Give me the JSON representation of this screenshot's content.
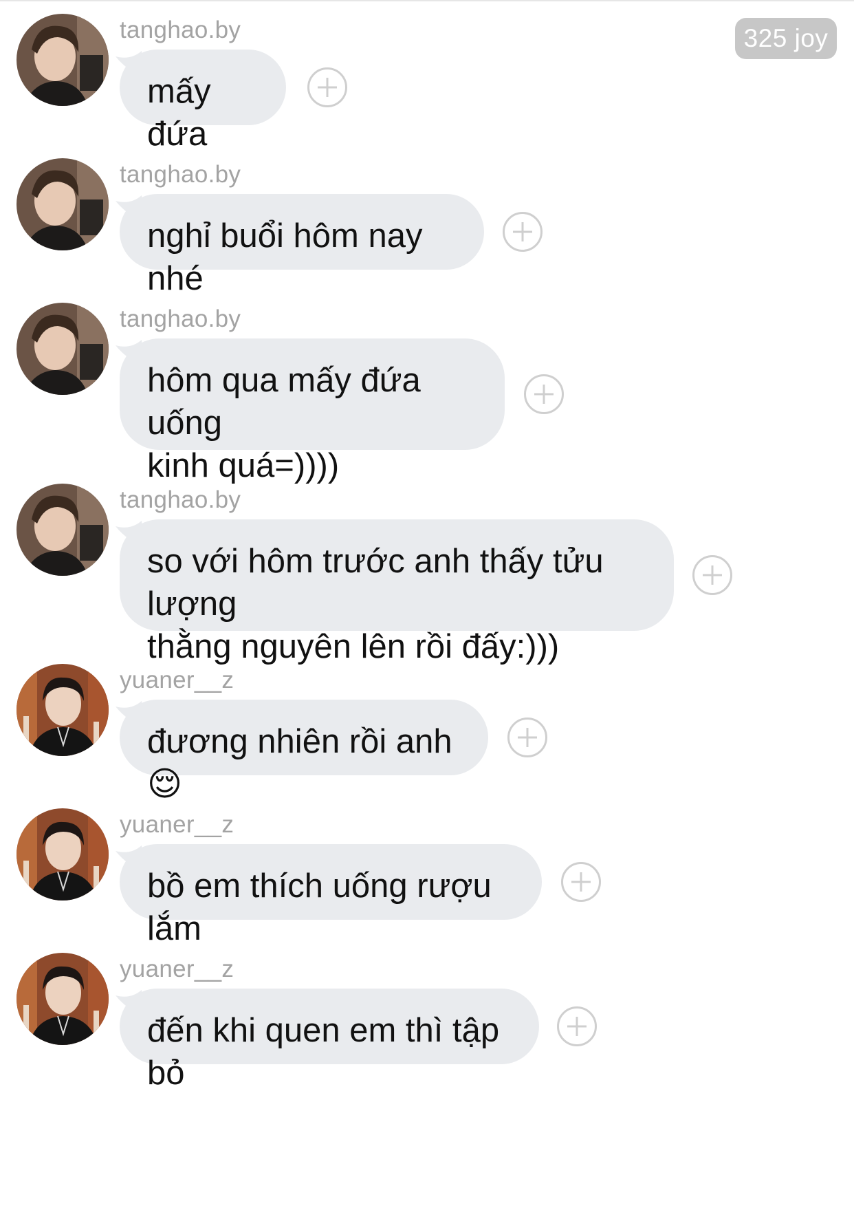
{
  "watermark": "325 joy",
  "messages": [
    {
      "user": "tanghao.by",
      "avatar": "avatar-tanghao",
      "text": "mấy đứa"
    },
    {
      "user": "tanghao.by",
      "avatar": "avatar-tanghao",
      "text": "nghỉ buổi hôm nay nhé"
    },
    {
      "user": "tanghao.by",
      "avatar": "avatar-tanghao",
      "text": "hôm qua mấy đứa uống\nkinh quá=))))"
    },
    {
      "user": "tanghao.by",
      "avatar": "avatar-tanghao",
      "text": "so với hôm trước anh thấy tửu lượng\nthằng nguyên lên rồi đấy:)))"
    },
    {
      "user": "yuaner__z",
      "avatar": "avatar-yuaner",
      "text": "đương nhiên rồi anh😌"
    },
    {
      "user": "yuaner__z",
      "avatar": "avatar-yuaner",
      "text": "bồ em thích uống rượu lắm"
    },
    {
      "user": "yuaner__z",
      "avatar": "avatar-yuaner",
      "text": "đến khi quen em thì tập bỏ"
    }
  ],
  "colors": {
    "bubble": "#e9ebee",
    "username": "#a3a3a3",
    "watermark_bg": "#c7c7c7",
    "add_icon": "#cfcfcf"
  },
  "icons": [
    "add-reaction-icon"
  ]
}
